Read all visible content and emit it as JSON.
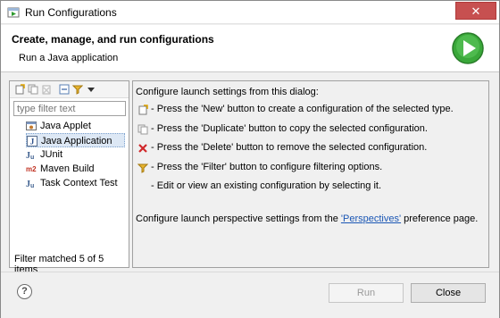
{
  "window": {
    "title": "Run Configurations",
    "title_icon": "run-configurations-icon",
    "close_glyph": "✕"
  },
  "header": {
    "title": "Create, manage, and run configurations",
    "subtitle": "Run a Java application",
    "icon": "run-icon",
    "accent": "#3aa83a"
  },
  "left": {
    "toolbar": [
      "new-config-icon",
      "duplicate-icon",
      "delete-icon",
      "collapse-all-icon",
      "filter-icon",
      "view-menu-icon"
    ],
    "filter_placeholder": "type filter text",
    "tree": [
      {
        "label": "Java Applet",
        "icon": "java-applet-icon",
        "glyph": "☕"
      },
      {
        "label": "Java Application",
        "icon": "java-application-icon",
        "glyph": "J",
        "selected": true
      },
      {
        "label": "JUnit",
        "icon": "junit-icon",
        "glyph": "Ju"
      },
      {
        "label": "Maven Build",
        "icon": "maven-icon",
        "glyph": "m2"
      },
      {
        "label": "Task Context Test",
        "icon": "task-context-test-icon",
        "glyph": "Ju"
      }
    ],
    "filter_status": "Filter matched 5 of 5 items"
  },
  "right": {
    "intro": "Configure launch settings from this dialog:",
    "items": [
      {
        "icon": "new-config-icon",
        "text": "- Press the 'New' button to create a configuration of the selected type."
      },
      {
        "icon": "duplicate-icon",
        "text": "- Press the 'Duplicate' button to copy the selected configuration."
      },
      {
        "icon": "delete-icon",
        "text": "- Press the 'Delete' button to remove the selected configuration."
      },
      {
        "icon": "filter-icon",
        "text": "- Press the 'Filter' button to configure filtering options."
      },
      {
        "icon": "",
        "text": "- Edit or view an existing configuration by selecting it."
      }
    ],
    "perspective_prefix": "Configure launch perspective settings from the ",
    "perspective_link": "'Perspectives'",
    "perspective_suffix": " preference page."
  },
  "footer": {
    "help": "?",
    "run_label": "Run",
    "close_label": "Close"
  }
}
